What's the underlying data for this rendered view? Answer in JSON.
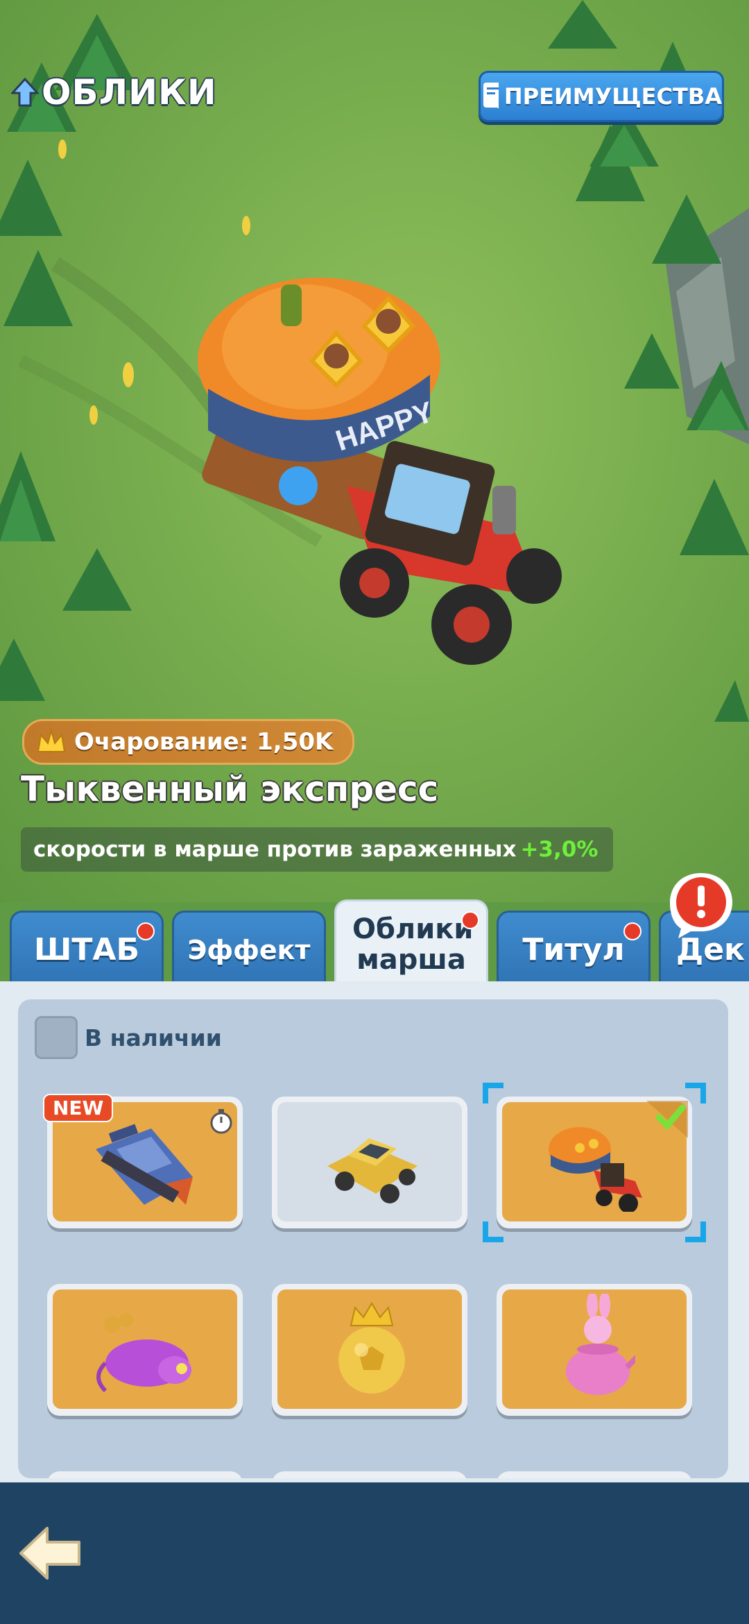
{
  "header": {
    "title": "ОБЛИКИ",
    "perks_label": "ПРЕИМУЩЕСТВА"
  },
  "skin": {
    "charm_label": "Очарование: 1,50K",
    "name": "Тыквенный экспресс",
    "bonus_text": "скорости в марше против зараженных",
    "bonus_value": "+3,0%",
    "trailer_text": "HAPPY"
  },
  "tabs": [
    {
      "label": "ШТАБ",
      "has_dot": true
    },
    {
      "label": "Эффект",
      "has_dot": false
    },
    {
      "label": "Облики марша",
      "has_dot": true,
      "active": true
    },
    {
      "label": "Титул",
      "has_dot": true
    },
    {
      "label": "Дек",
      "has_dot": false
    }
  ],
  "filter": {
    "label": "В наличии",
    "checked": false
  },
  "grid": [
    {
      "name": "tank-skin",
      "badge": "NEW",
      "timer": true,
      "owned": true
    },
    {
      "name": "jeep-skin",
      "owned": false
    },
    {
      "name": "pumpkin-tractor-skin",
      "selected": true,
      "equipped": true,
      "owned": true
    },
    {
      "name": "purple-rat-skin",
      "owned": true
    },
    {
      "name": "golden-ball-crown-skin",
      "owned": true
    },
    {
      "name": "bunny-teapot-skin",
      "owned": true
    }
  ],
  "colors": {
    "accent_blue": "#2c7fd1",
    "card_orange": "#e7a848",
    "alert_red": "#e53a28",
    "bonus_green": "#6ef03a"
  }
}
